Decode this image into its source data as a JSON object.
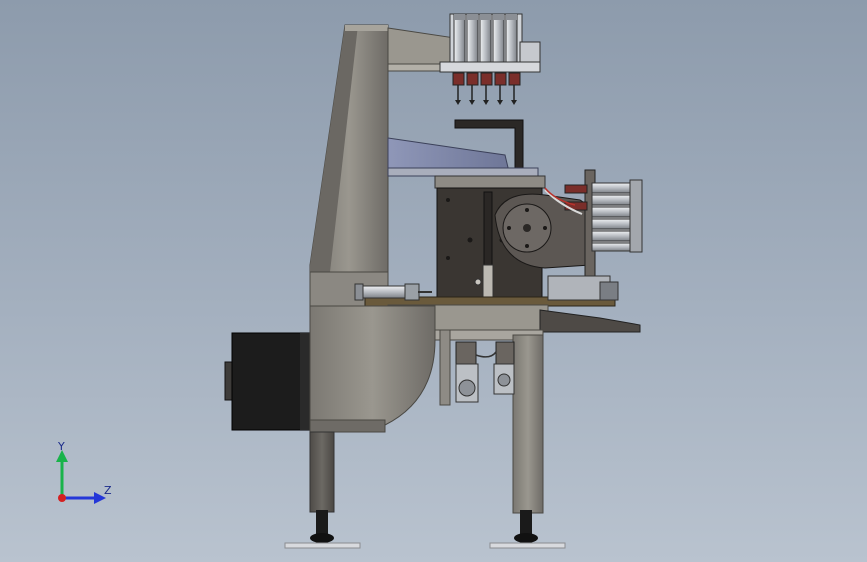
{
  "viewport": {
    "background_top": "#8d9bac",
    "background_bottom": "#b9c3cf"
  },
  "triad": {
    "y_label": "Y",
    "z_label": "Z",
    "y_color": "#19b34a",
    "z_color": "#2437d8",
    "x_color": "#d42020"
  },
  "colors": {
    "frame": "#8a8780",
    "frame_dark": "#5f5c57",
    "motor": "#1c1c1c",
    "plate": "#3a3632",
    "cylinder": "#cfd3d8",
    "accent_red": "#b8322c"
  }
}
